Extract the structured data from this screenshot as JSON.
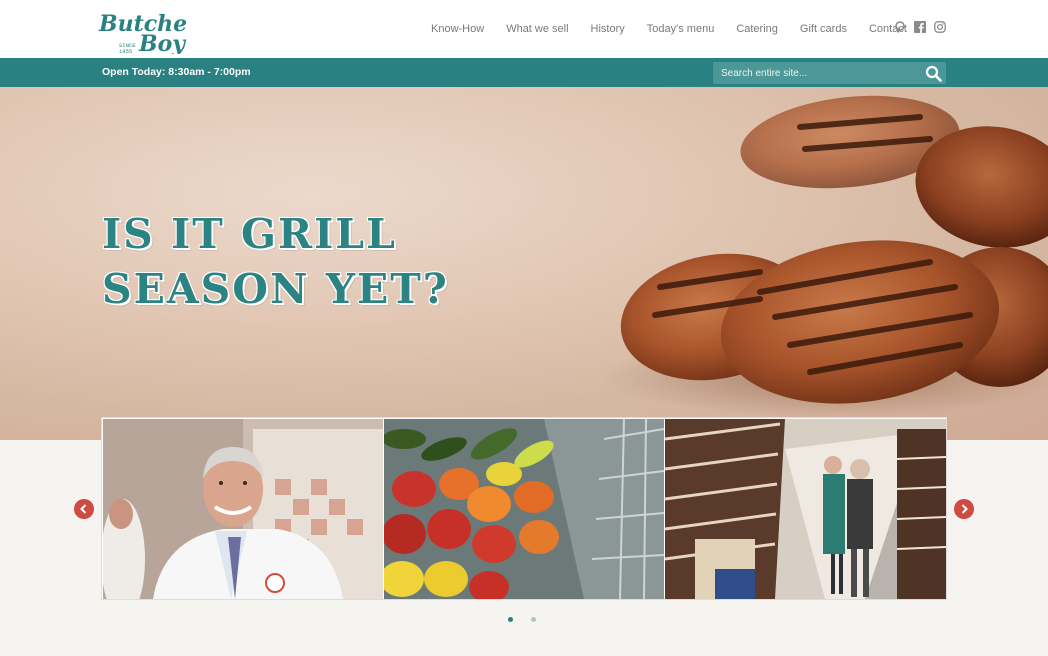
{
  "brand": {
    "name_line1": "Butcher",
    "name_line2": "Boy",
    "since": "SINCE",
    "year": "1955"
  },
  "nav": {
    "items": [
      {
        "label": "Know-How"
      },
      {
        "label": "What we sell"
      },
      {
        "label": "History"
      },
      {
        "label": "Today's menu"
      },
      {
        "label": "Catering"
      },
      {
        "label": "Gift cards"
      },
      {
        "label": "Contact"
      }
    ]
  },
  "social": {
    "icons": [
      "pinterest-icon",
      "facebook-icon",
      "instagram-icon"
    ]
  },
  "bar": {
    "hours": "Open Today: 8:30am - 7:00pm"
  },
  "search": {
    "placeholder": "Search entire site...",
    "value": ""
  },
  "hero": {
    "line1": "IS IT GRILL",
    "line2": "SEASON YET?"
  },
  "carousel": {
    "slides": [
      "butcher-photo",
      "peppers-photo",
      "wine-aisle-photo"
    ],
    "page_count": 2,
    "active_page": 1
  },
  "colors": {
    "accent": "#2a8181",
    "arrow": "#cf4a41",
    "nav_text": "#7a7a7a"
  }
}
